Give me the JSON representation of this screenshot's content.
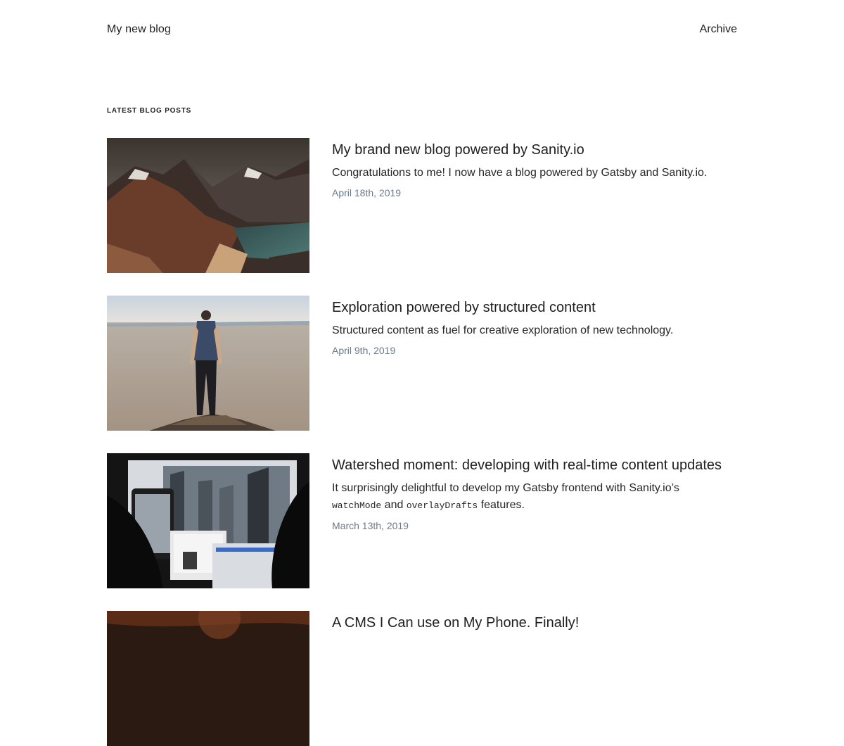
{
  "header": {
    "site_title": "My new blog",
    "nav": {
      "archive_label": "Archive"
    }
  },
  "main": {
    "section_heading": "Latest blog posts",
    "posts": [
      {
        "title": "My brand new blog powered by Sanity.io",
        "excerpt": "Congratulations to me! I now have a blog powered by Gatsby and Sanity.io.",
        "date": "April 18th, 2019",
        "image": "mountain-coast-photo"
      },
      {
        "title": "Exploration powered by structured content",
        "excerpt": "Structured content as fuel for creative exploration of new technology.",
        "date": "April 9th, 2019",
        "image": "man-on-rock-desert-photo"
      },
      {
        "title": "Watershed moment: developing with real-time content updates",
        "excerpt_parts": {
          "before": "It surprisingly delightful to develop my Gatsby frontend with Sanity.io’s",
          "code1": "watchMode",
          "middle": " and ",
          "code2": "overlayDrafts",
          "after": " features."
        },
        "date": "March 13th, 2019",
        "image": "laptops-city-screen-photo"
      },
      {
        "title": "A CMS I Can use on My Phone. Finally!",
        "image": "dark-warm-photo"
      }
    ]
  },
  "colors": {
    "text": "#1f1f1f",
    "date": "#6b7a8c"
  }
}
